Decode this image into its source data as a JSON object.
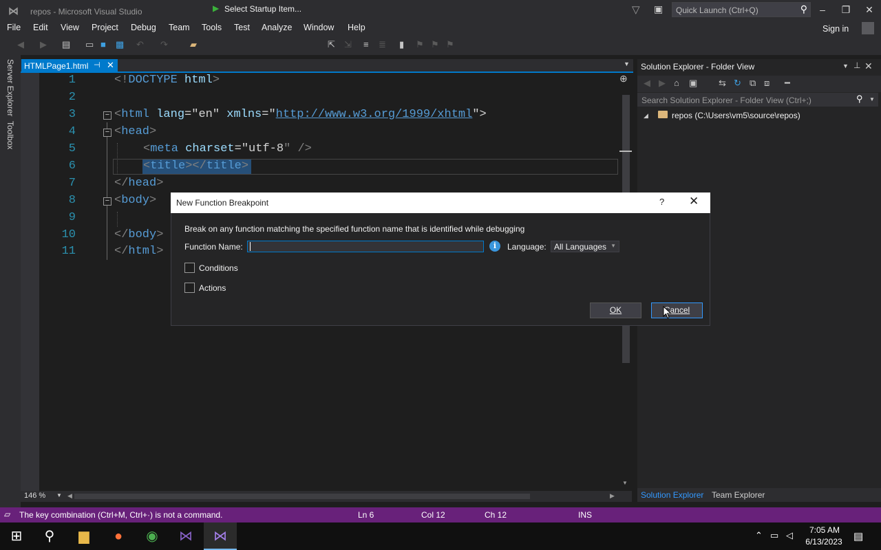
{
  "window": {
    "title": "repos - Microsoft Visual Studio",
    "quick_launch_placeholder": "Quick Launch (Ctrl+Q)",
    "sign_in": "Sign in"
  },
  "menu": [
    "File",
    "Edit",
    "View",
    "Project",
    "Debug",
    "Team",
    "Tools",
    "Test",
    "Analyze",
    "Window",
    "Help"
  ],
  "toolbar": {
    "startup_item": "Select Startup Item..."
  },
  "left_tabs": {
    "server_explorer": "Server Explorer",
    "toolbox": "Toolbox"
  },
  "editor": {
    "tab_label": "HTMLPage1.html",
    "line_numbers": [
      "1",
      "2",
      "3",
      "4",
      "5",
      "6",
      "7",
      "8",
      "9",
      "10",
      "11"
    ],
    "code": {
      "l1_bracket_open": "<!",
      "l1_doctype": "DOCTYPE",
      "l1_html": " html",
      "l1_bracket_close": ">",
      "l3_open": "<",
      "l3_tag": "html",
      "l3_attr1": " lang",
      "l3_eq1": "=\"",
      "l3_val1": "en",
      "l3_q1": "\"",
      "l3_attr2": " xmlns",
      "l3_eq2": "=\"",
      "l3_url": "http://www.w3.org/1999/xhtml",
      "l3_close": "\">",
      "l4_open": "<",
      "l4_tag": "head",
      "l4_close": ">",
      "l5_open": "<",
      "l5_tag": "meta",
      "l5_attr": " charset",
      "l5_eq": "=\"",
      "l5_val": "utf-8",
      "l5_close": "\" />",
      "l6_open": "<",
      "l6_tag": "title",
      "l6_mid": "></",
      "l6_tag2": "title",
      "l6_close": ">",
      "l7_open": "</",
      "l7_tag": "head",
      "l7_close": ">",
      "l8_open": "<",
      "l8_tag": "body",
      "l8_close": ">",
      "l10_open": "</",
      "l10_tag": "body",
      "l10_close": ">",
      "l11_open": "</",
      "l11_tag": "html",
      "l11_close": ">"
    },
    "zoom": "146 %"
  },
  "solution_explorer": {
    "title": "Solution Explorer - Folder View",
    "search_placeholder": "Search Solution Explorer - Folder View (Ctrl+;)",
    "root_item": "repos (C:\\Users\\vm5\\source\\repos)",
    "tab_solution": "Solution Explorer",
    "tab_team": "Team Explorer"
  },
  "status": {
    "message": "The key combination (Ctrl+M, Ctrl+·) is not a command.",
    "line": "Ln 6",
    "col": "Col 12",
    "ch": "Ch 12",
    "mode": "INS"
  },
  "taskbar": {
    "time": "7:05 AM",
    "date": "6/13/2023"
  },
  "dialog": {
    "title": "New Function Breakpoint",
    "help": "?",
    "description": "Break on any function matching the specified function name that is identified while debugging",
    "function_name_label": "Function Name:",
    "function_name_value": "",
    "language_label": "Language:",
    "language_value": "All Languages",
    "conditions_label": "Conditions",
    "conditions_checked": false,
    "actions_label": "Actions",
    "actions_checked": false,
    "ok_label": "OK",
    "cancel_label": "Cancel"
  },
  "colors": {
    "accent": "#007acc",
    "status_bar": "#68217a",
    "background": "#1e1e1e"
  }
}
